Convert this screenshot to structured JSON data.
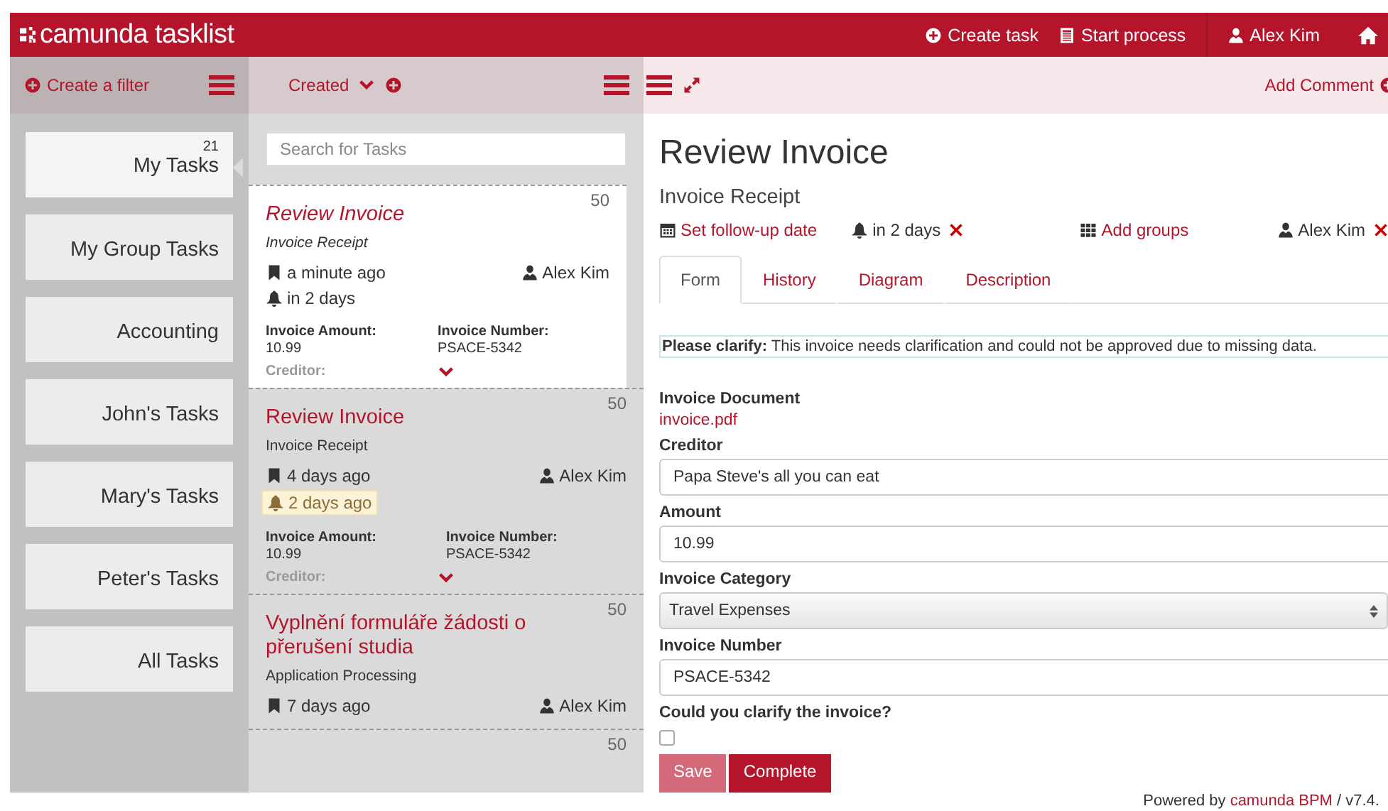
{
  "header": {
    "logo": "camunda tasklist",
    "actions": [
      "Create task",
      "Start process"
    ],
    "user": "Alex Kim"
  },
  "toolbar": {
    "create_filter": "Create a filter",
    "sort": "Created",
    "add_comment": "Add Comment"
  },
  "filters": [
    {
      "name": "My Tasks",
      "count": "21",
      "selected": true
    },
    {
      "name": "My Group Tasks",
      "selected": false
    },
    {
      "name": "Accounting",
      "selected": false
    },
    {
      "name": "John's Tasks",
      "selected": false
    },
    {
      "name": "Mary's Tasks",
      "selected": false
    },
    {
      "name": "Peter's Tasks",
      "selected": false
    },
    {
      "name": "All Tasks",
      "selected": false
    }
  ],
  "search": {
    "placeholder": "Search for Tasks"
  },
  "tasks": [
    {
      "name": "Review Invoice",
      "process": "Invoice Receipt",
      "selected": true,
      "priority": "50",
      "created": "a minute ago",
      "assignee": "Alex Kim",
      "due": {
        "text": "in 2 days",
        "overdue": false
      },
      "variables": [
        {
          "label": "Invoice Amount:",
          "value": "10.99"
        },
        {
          "label": "Invoice Number:",
          "value": "PSACE-5342"
        }
      ],
      "more": "Creditor:"
    },
    {
      "name": "Review Invoice",
      "process": "Invoice Receipt",
      "selected": false,
      "priority": "50",
      "created": "4 days ago",
      "assignee": "Alex Kim",
      "due": {
        "text": "2 days ago",
        "overdue": true
      },
      "variables": [
        {
          "label": "Invoice Amount:",
          "value": "10.99"
        },
        {
          "label": "Invoice Number:",
          "value": "PSACE-5342"
        }
      ],
      "more": "Creditor:"
    },
    {
      "name": "Vyplnění formuláře žádosti o přerušení studia",
      "process": "Application Processing",
      "selected": false,
      "priority": "50",
      "created": "7 days ago",
      "assignee": "Alex Kim"
    },
    {
      "selected": false,
      "priority": "50"
    }
  ],
  "detail": {
    "title": "Review Invoice",
    "process": "Invoice Receipt",
    "follow_up": "Set follow-up date",
    "due": "in 2 days",
    "groups": "Add groups",
    "assignee": "Alex Kim",
    "tabs": [
      {
        "label": "Form",
        "selected": true
      },
      {
        "label": "History",
        "selected": false
      },
      {
        "label": "Diagram",
        "selected": false
      },
      {
        "label": "Description",
        "selected": false
      }
    ],
    "notice": "**Please clarify:** This invoice needs clarification and could not be approved due to missing data.",
    "fields": [
      {
        "kind": "link",
        "label": "Invoice Document",
        "value": "invoice.pdf"
      },
      {
        "kind": "text",
        "label": "Creditor",
        "value": "Papa Steve's all you can eat"
      },
      {
        "kind": "text",
        "label": "Amount",
        "value": "10.99"
      },
      {
        "kind": "select",
        "label": "Invoice Category",
        "value": "Travel Expenses"
      },
      {
        "kind": "text",
        "label": "Invoice Number",
        "value": "PSACE-5342"
      },
      {
        "kind": "checkbox",
        "label": "Could you clarify the invoice?",
        "checked": false
      }
    ],
    "buttons": [
      {
        "label": "Save",
        "disabled": true
      },
      {
        "label": "Complete",
        "disabled": false
      }
    ]
  },
  "footer": {
    "text": "Powered by",
    "link": "camunda BPM",
    "version": "/ v7.4."
  }
}
